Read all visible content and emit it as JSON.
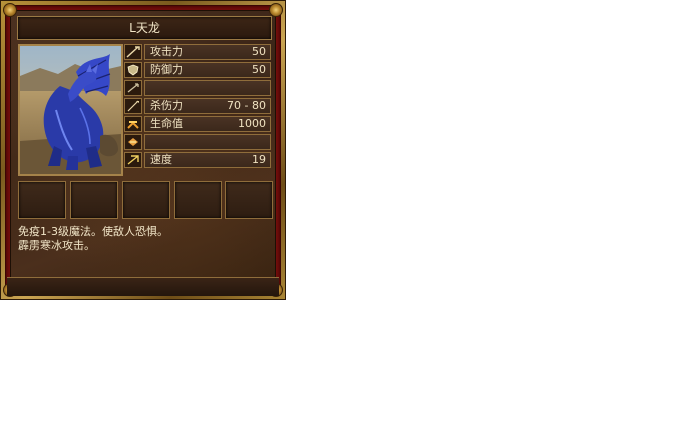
{
  "unit": {
    "name": "L天龙",
    "portrait_icon": "blue-dragon-portrait"
  },
  "stats": [
    {
      "icon": "sword-icon",
      "label": "攻击力",
      "value": "50"
    },
    {
      "icon": "shield-icon",
      "label": "防御力",
      "value": "50"
    },
    {
      "icon": "arrow-icon",
      "label": "",
      "value": ""
    },
    {
      "icon": "spear-icon",
      "label": "杀伤力",
      "value": "70 - 80"
    },
    {
      "icon": "heart-icon",
      "label": "生命值",
      "value": "1000"
    },
    {
      "icon": "spell-icon",
      "label": "",
      "value": ""
    },
    {
      "icon": "speed-icon",
      "label": "速度",
      "value": "19"
    }
  ],
  "slots": [
    "",
    "",
    "",
    "",
    ""
  ],
  "description": {
    "line1": "免疫1-3级魔法。使敌人恐惧。",
    "line2": "霹雳寒冰攻击。"
  }
}
